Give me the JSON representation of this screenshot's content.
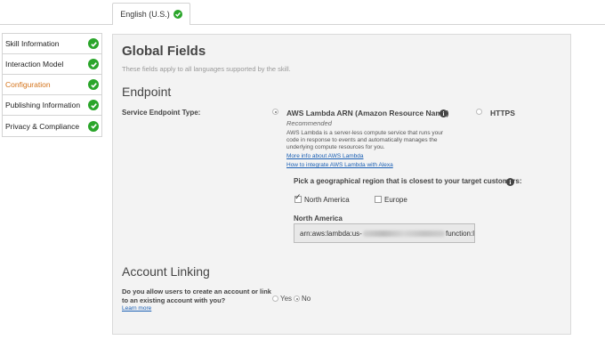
{
  "language_tab": {
    "label": "English (U.S.)"
  },
  "sidebar": {
    "items": [
      {
        "label": "Skill Information"
      },
      {
        "label": "Interaction Model"
      },
      {
        "label": "Configuration"
      },
      {
        "label": "Publishing Information"
      },
      {
        "label": "Privacy & Compliance"
      }
    ]
  },
  "global_fields": {
    "title": "Global Fields",
    "subtitle": "These fields apply to all languages supported by the skill."
  },
  "endpoint": {
    "heading": "Endpoint",
    "service_type_label": "Service Endpoint Type:",
    "lambda": {
      "label": "AWS Lambda ARN (Amazon Resource Name)",
      "recommended": "Recommended",
      "description": "AWS Lambda is a server-less compute service that runs your code in response to events and automatically manages the underlying compute resources for you.",
      "link_more": "More info about AWS Lambda",
      "link_how": "How to integrate AWS Lambda with Alexa"
    },
    "https": {
      "label": "HTTPS"
    },
    "region_prompt": "Pick a geographical region that is closest to your target customers:",
    "regions": {
      "north_america": "North America",
      "europe": "Europe"
    },
    "na_field_label": "North America",
    "arn_prefix": "arn:aws:lambda:us-",
    "arn_suffix": "function:l"
  },
  "account_linking": {
    "heading": "Account Linking",
    "question": "Do you allow users to create an account or link to an existing account with you?",
    "learn_more": "Learn more",
    "yes": "Yes",
    "no": "No"
  },
  "colors": {
    "check_green": "#2aa52a",
    "active_orange": "#d4731a",
    "link_blue": "#1a5fb4"
  }
}
